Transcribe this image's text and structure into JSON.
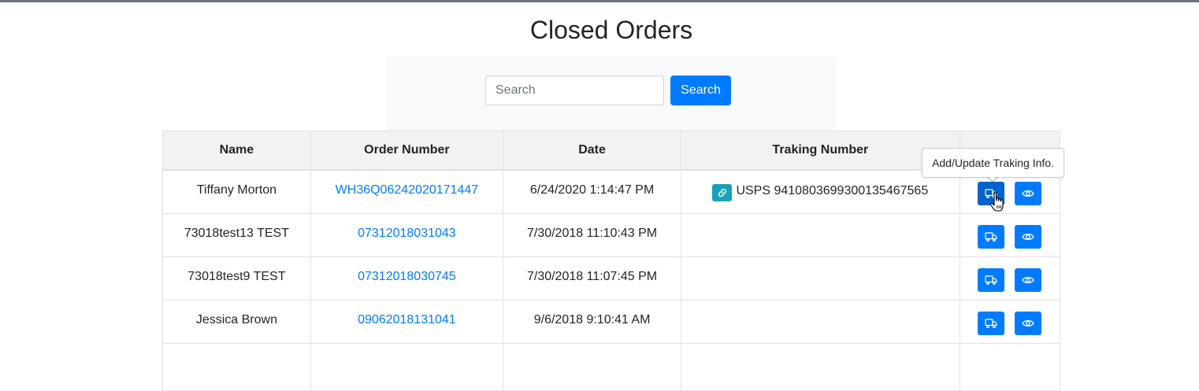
{
  "page": {
    "title": "Closed Orders"
  },
  "search": {
    "placeholder": "Search",
    "value": "",
    "button_label": "Search"
  },
  "table": {
    "headers": {
      "name": "Name",
      "order_number": "Order Number",
      "date": "Date",
      "tracking_number": "Traking Number",
      "actions": ""
    },
    "rows": [
      {
        "name": "Tiffany Morton",
        "order_number": "WH36Q06242020171447",
        "date": "6/24/2020 1:14:47 PM",
        "tracking": "USPS 9410803699300135467565"
      },
      {
        "name": "73018test13 TEST",
        "order_number": "07312018031043",
        "date": "7/30/2018 11:10:43 PM",
        "tracking": ""
      },
      {
        "name": "73018test9 TEST",
        "order_number": "07312018030745",
        "date": "7/30/2018 11:07:45 PM",
        "tracking": ""
      },
      {
        "name": "Jessica Brown",
        "order_number": "09062018131041",
        "date": "9/6/2018 9:10:41 AM",
        "tracking": ""
      }
    ]
  },
  "tooltip": {
    "text": "Add/Update Traking Info."
  },
  "icons": {
    "tracking_link": "link-icon",
    "shipping_action": "truck-icon",
    "view_action": "eye-icon"
  },
  "colors": {
    "primary": "#007bff",
    "primary_hover": "#0062cc",
    "link_badge": "#17a2b8",
    "header_bg": "#f2f2f2",
    "search_panel_bg": "#f8f9fa"
  }
}
